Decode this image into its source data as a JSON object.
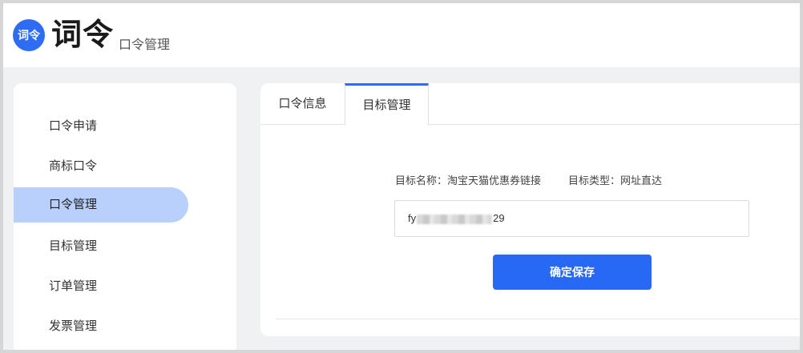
{
  "header": {
    "logo_text": "词令",
    "title": "词令",
    "subtitle": "口令管理"
  },
  "sidebar": {
    "items": [
      {
        "label": "口令申请"
      },
      {
        "label": "商标口令"
      },
      {
        "label": "口令管理",
        "active": true
      },
      {
        "label": "目标管理"
      },
      {
        "label": "订单管理"
      },
      {
        "label": "发票管理"
      }
    ]
  },
  "tabs": [
    {
      "label": "口令信息"
    },
    {
      "label": "目标管理",
      "active": true
    }
  ],
  "target": {
    "name_label": "目标名称：",
    "name_value": "淘宝天猫优惠券链接",
    "type_label": "目标类型：",
    "type_value": "网址直达",
    "input_prefix": "fy",
    "input_suffix": "29"
  },
  "save_button": "确定保存",
  "colors": {
    "accent": "#2768f5",
    "active_item_bg": "#b8d0fb"
  }
}
